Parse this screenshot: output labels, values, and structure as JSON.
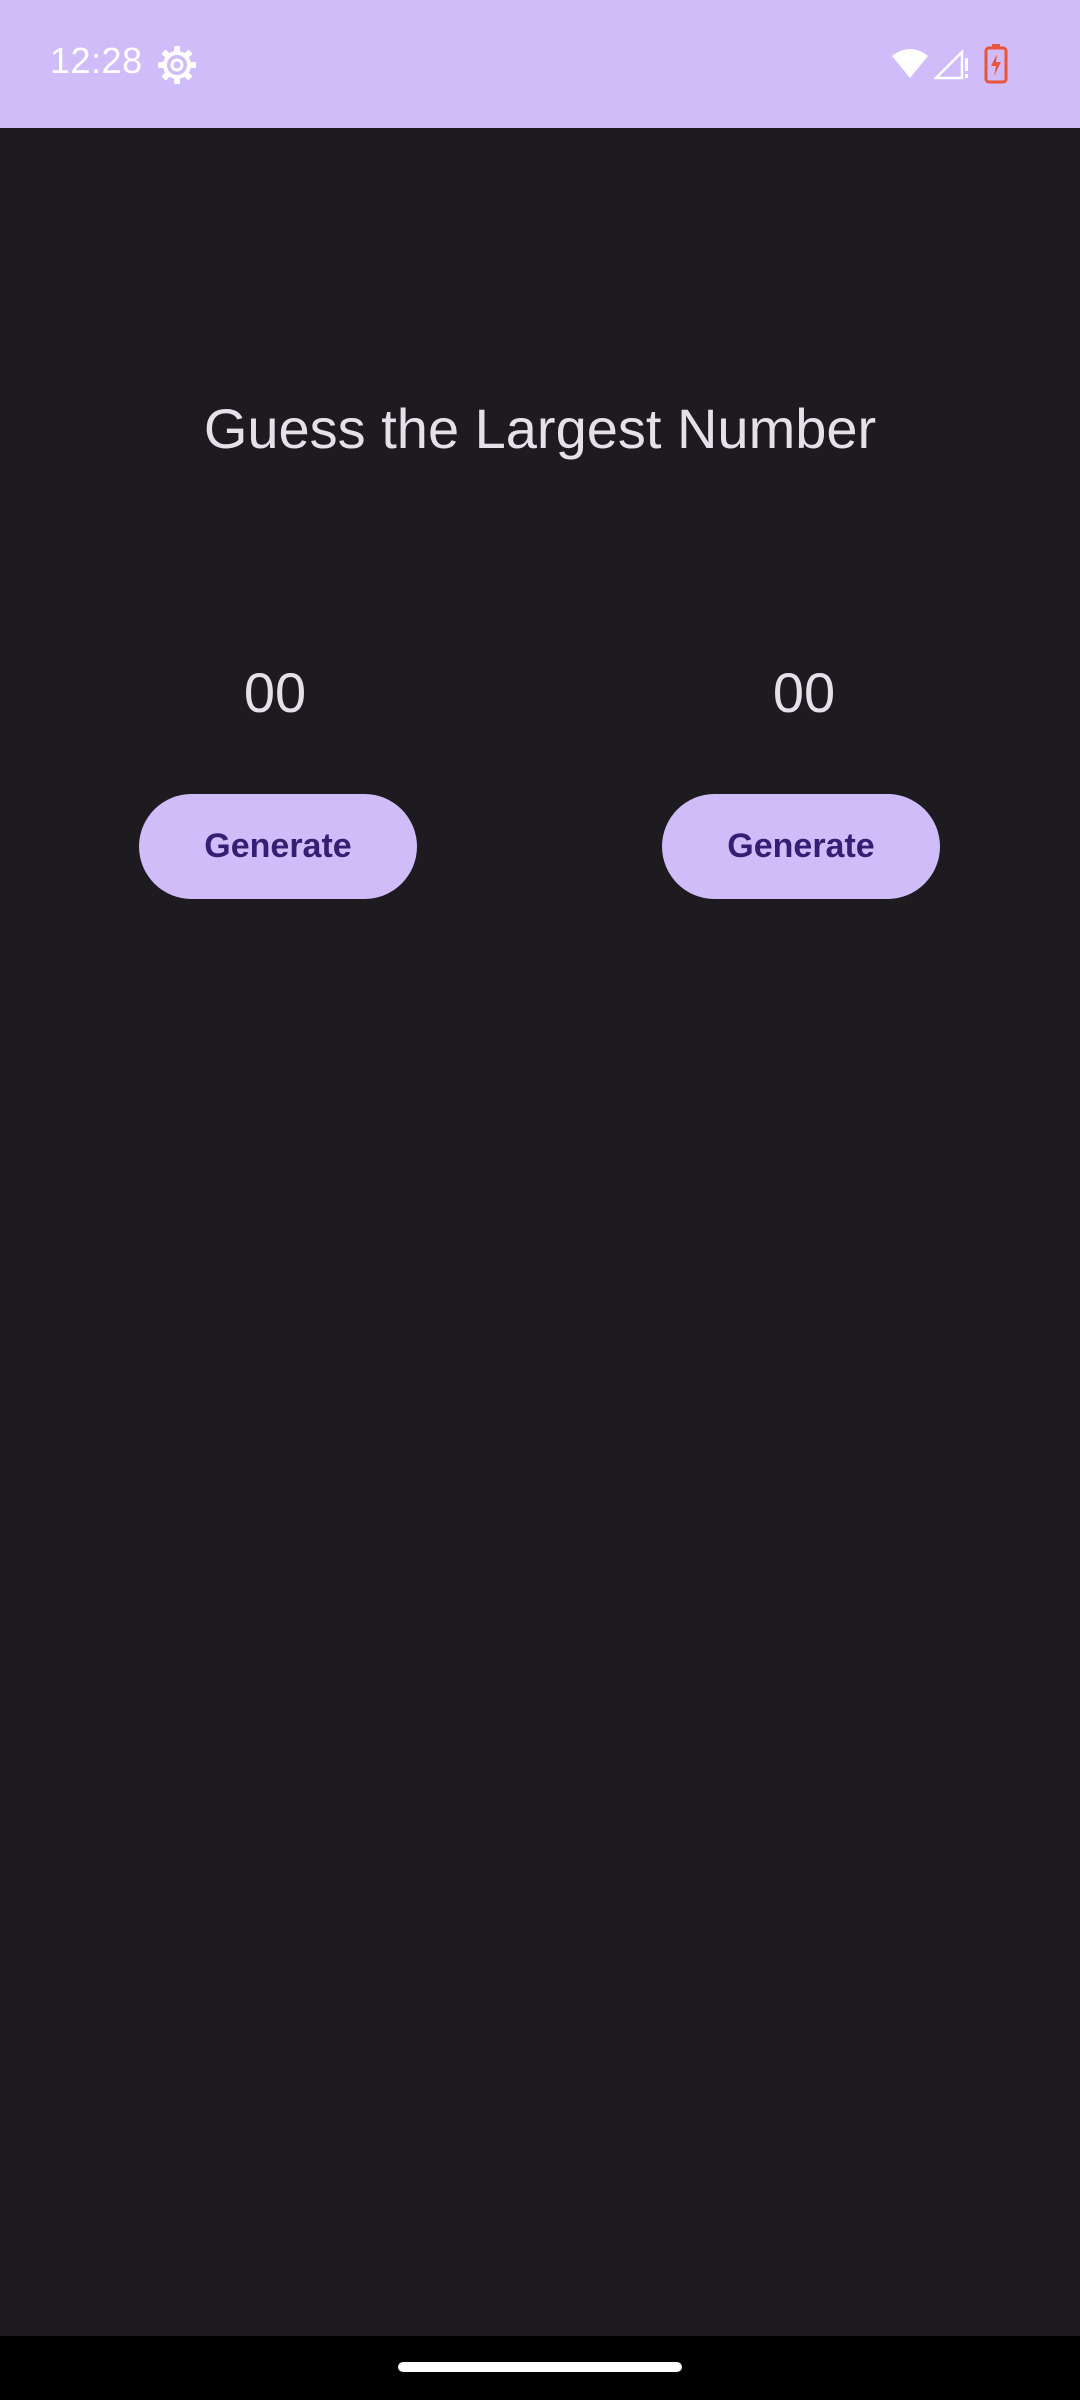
{
  "status_bar": {
    "time": "12:28",
    "background_color": "#cfbcf9",
    "icons": [
      "gear-icon",
      "wifi-icon",
      "signal-icon",
      "battery-charging-icon"
    ]
  },
  "main": {
    "title": "Guess the Largest Number",
    "left": {
      "number": "00",
      "button_label": "Generate"
    },
    "right": {
      "number": "00",
      "button_label": "Generate"
    }
  },
  "colors": {
    "background": "#1d1b20",
    "accent": "#cfbcf9",
    "button_text": "#381e72",
    "text": "#e6e0e9",
    "battery": "#e8553a"
  }
}
